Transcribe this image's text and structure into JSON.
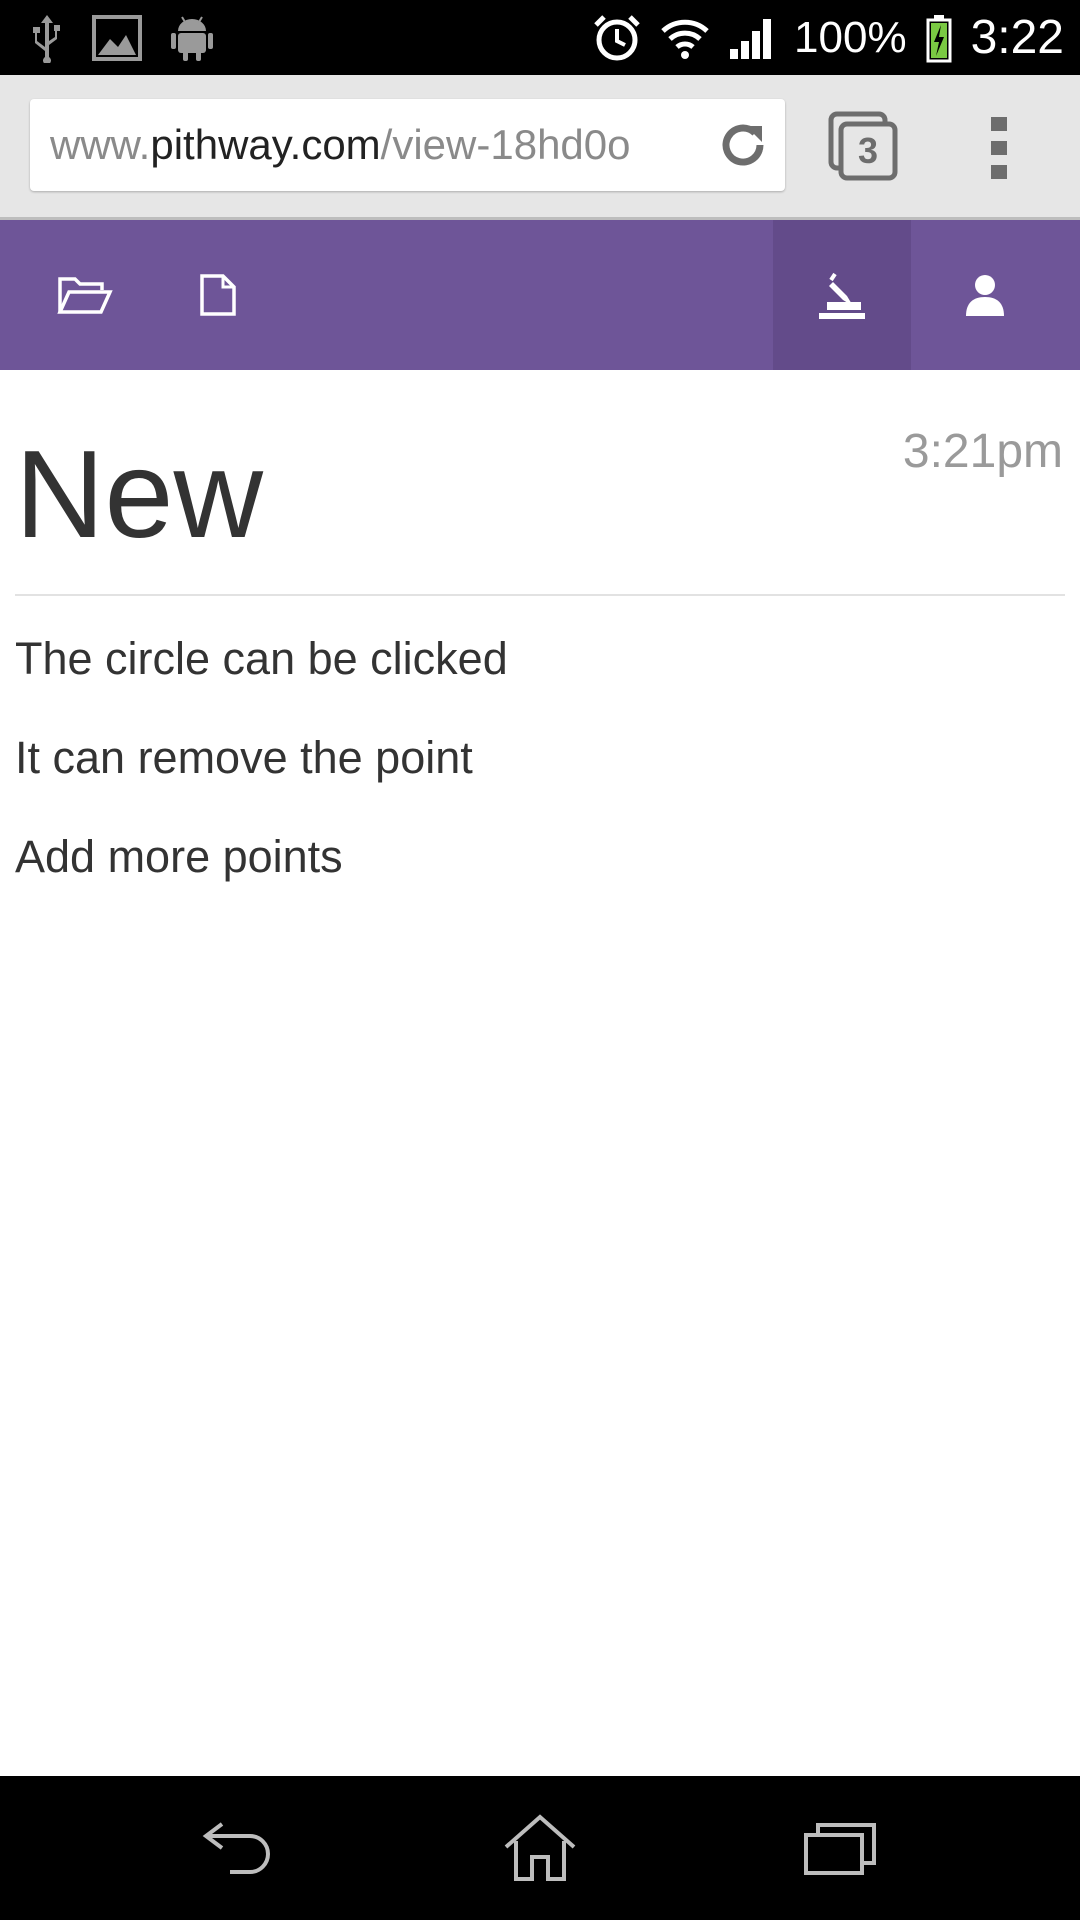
{
  "status_bar": {
    "battery": "100%",
    "time": "3:22"
  },
  "browser": {
    "url_prefix": "www.",
    "url_domain": "pithway.com",
    "url_path": "/view-18hd0o",
    "tab_count": "3"
  },
  "note": {
    "title": "New",
    "timestamp": "3:21pm",
    "points": [
      "The circle can be clicked",
      "It can remove the point",
      "Add more points"
    ]
  },
  "colors": {
    "toolbar": "#6e5598",
    "toolbar_active": "#634b8a",
    "status_bar": "#000000"
  },
  "icons": {
    "status_left": [
      "usb-icon",
      "image-icon",
      "android-icon"
    ],
    "status_right": [
      "alarm-icon",
      "wifi-icon",
      "signal-icon",
      "battery-charging-icon"
    ],
    "toolbar": [
      "folder-open-icon",
      "file-icon",
      "pen-sign-icon",
      "user-icon"
    ],
    "nav": [
      "back-icon",
      "home-icon",
      "recent-apps-icon"
    ]
  }
}
